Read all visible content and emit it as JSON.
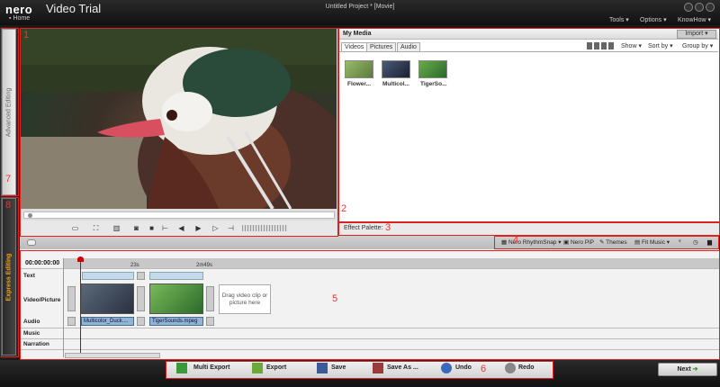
{
  "app": {
    "logo": "nero",
    "name": "Video Trial",
    "project": "Untitled Project * [Movie]",
    "home": "Home"
  },
  "menu": [
    "Tools ▾",
    "Options ▾",
    "KnowHow ▾"
  ],
  "tabs": {
    "advanced": "Advanced Editing",
    "express": "Express Editing"
  },
  "media": {
    "title": "My Media",
    "import": "Import ▾",
    "tabs": [
      "Videos",
      "Pictures",
      "Audio"
    ],
    "show": "Show ▾",
    "sort": "Sort by ▾",
    "group": "Group by ▾",
    "items": [
      {
        "label": "Flower...",
        "color": "#7a9a5a"
      },
      {
        "label": "Multicol...",
        "color": "#2a3a5a"
      },
      {
        "label": "TigerSo...",
        "color": "#4a8a3a"
      }
    ]
  },
  "effect": "Effect Palette:",
  "share": [
    "Nero RhythmSnap ▾",
    "Nero PiP",
    "Themes",
    "Fit Music ▾"
  ],
  "timeline": {
    "timecode": "00:00:00:00",
    "ticks": [
      "23s",
      "2m49s"
    ],
    "tracks": [
      "Text",
      "Video/Picture",
      "Audio",
      "Music",
      "Narration"
    ],
    "clips": [
      "Multicolor_Duck....",
      "TigerSounds.mpeg"
    ],
    "drop": "Drag video clip or picture here"
  },
  "actions": [
    "Multi Export",
    "Export",
    "Save",
    "Save As ...",
    "Undo",
    "Redo"
  ],
  "next": "Next",
  "annotations": [
    "1",
    "2",
    "3",
    "4",
    "5",
    "6",
    "7",
    "8"
  ]
}
